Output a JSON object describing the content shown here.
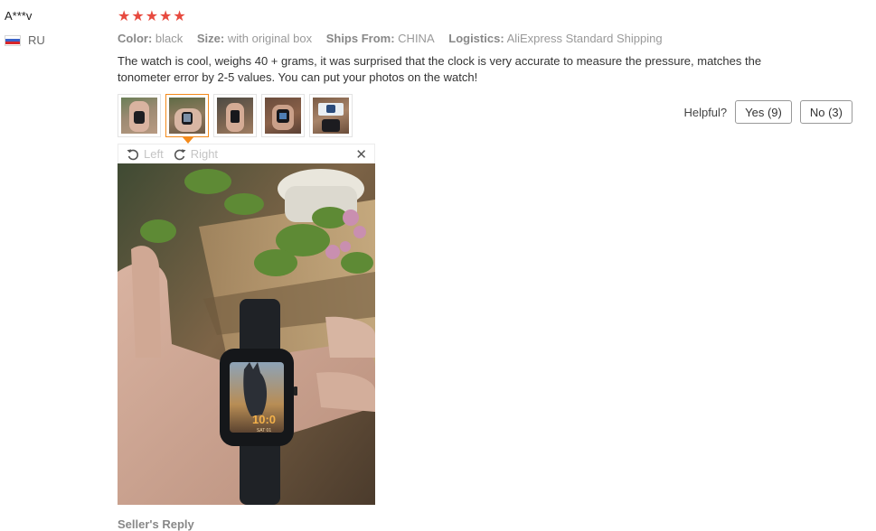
{
  "user": {
    "name": "A***v",
    "country": "RU"
  },
  "rating": {
    "stars": 5
  },
  "attributes": [
    {
      "key": "Color:",
      "value": "black"
    },
    {
      "key": "Size:",
      "value": "with original box"
    },
    {
      "key": "Ships From:",
      "value": "CHINA"
    },
    {
      "key": "Logistics:",
      "value": "AliExpress Standard Shipping"
    }
  ],
  "review_text": "The watch is cool, weighs 40 + grams, it was surprised that the clock is very accurate to measure the pressure, matches the tonometer error by 2-5 values. You can put your photos on the watch!",
  "thumbnails": [
    {
      "icon": "photo-watch-wrist",
      "active": false
    },
    {
      "icon": "photo-watch-hand",
      "active": true
    },
    {
      "icon": "photo-watch-side",
      "active": false
    },
    {
      "icon": "photo-watch-front",
      "active": false
    },
    {
      "icon": "photo-watch-box",
      "active": false
    }
  ],
  "helpful": {
    "label": "Helpful?",
    "yes_label": "Yes (9)",
    "no_label": "No (3)"
  },
  "viewer": {
    "rotate_left_label": "Left",
    "rotate_right_label": "Right",
    "close_glyph": "✕",
    "watch_time": "10:0",
    "watch_date": "SAT 01"
  },
  "seller_reply_label": "Seller's Reply",
  "colors": {
    "star": "#e74a3f",
    "active_border": "#f48a1a",
    "muted_text": "#999999"
  }
}
